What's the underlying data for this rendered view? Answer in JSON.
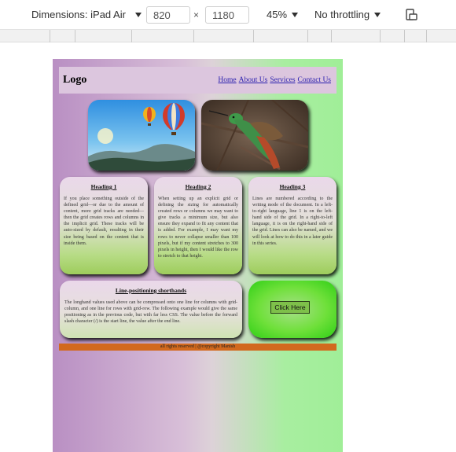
{
  "devtools": {
    "device_label": "Dimensions: iPad Air",
    "width_value": "820",
    "height_value": "1180",
    "times": "×",
    "zoom_label": "45%",
    "throttle_label": "No throttling"
  },
  "site": {
    "logo": "Logo",
    "nav": [
      "Home",
      "About Us",
      "Services",
      "Contact Us"
    ],
    "cards": [
      {
        "heading": "Heading 1",
        "text": "If you place something outside of the defined grid—or due to the amount of content, more grid tracks are needed—then the grid creates rows and columns in the implicit grid. These tracks will be auto-sized by default, resulting in their size being based on the content that is inside them."
      },
      {
        "heading": "Heading 2",
        "text": "When setting up an explicit grid or defining the sizing for automatically created rows or columns we may want to give tracks a minimum size, but also ensure they expand to fit any content that is added. For example, I may want my rows to never collapse smaller than 100 pixels, but if my content stretches to 300 pixels in height, then I would like the row to stretch to that height."
      },
      {
        "heading": "Heading 3",
        "text": "Lines are numbered according to the writing mode of the document. In a left-to-right language, line 1 is on the left-hand side of the grid. In a right-to-left language, it is on the right-hand side of the grid. Lines can also be named, and we will look at how to do this in a later guide in this series."
      }
    ],
    "wide_card": {
      "heading": "Line-positioning shorthands",
      "text": "The longhand values used above can be compressed onto one line for columns with grid-column, and one line for rows with grid-row. The following example would give the same positioning as in the previous code, but with far less CSS. The value before the forward slash character (/) is the start line, the value after the end line."
    },
    "button_label": "Click Here",
    "footer": "all rights reserved | @copyright Manish"
  },
  "colors": {
    "footer_bar": "#d2691e",
    "nav_link": "#2a1fae",
    "button": "#7ec04a"
  }
}
